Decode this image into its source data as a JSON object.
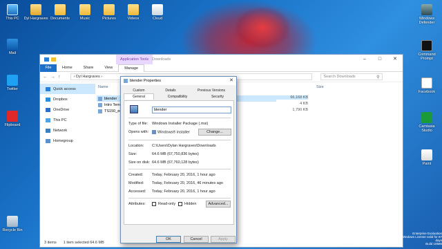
{
  "desktop": {
    "top_icons": [
      {
        "label": "This PC",
        "icon": "computer-icon"
      },
      {
        "label": "Dyl Hargraves",
        "icon": "user-folder-icon"
      },
      {
        "label": "Documents",
        "icon": "folder-icon"
      },
      {
        "label": "Music",
        "icon": "folder-icon"
      },
      {
        "label": "Pictures",
        "icon": "folder-icon"
      },
      {
        "label": "Videos",
        "icon": "folder-icon"
      },
      {
        "label": "Cloud",
        "icon": "cloud-icon"
      }
    ],
    "left_icons": [
      {
        "label": "Mail",
        "icon": "mail-icon"
      },
      {
        "label": "Twitter",
        "icon": "twitter-icon"
      },
      {
        "label": "Flipboard",
        "icon": "flipboard-icon"
      },
      {
        "label": "Recycle Bin",
        "icon": "recycle-bin-icon"
      }
    ],
    "right_icons": [
      {
        "label": "Windows Defender",
        "icon": "defender-icon"
      },
      {
        "label": "Command Prompt",
        "icon": "cmd-icon"
      },
      {
        "label": "Facebook",
        "icon": "facebook-icon"
      },
      {
        "label": "Camtasia Studio",
        "icon": "camtasia-icon"
      },
      {
        "label": "Paint",
        "icon": "paint-icon"
      }
    ],
    "eval_text": "Enterprise Evaluation\nWindows License valid for 87 days\nBuild 10586"
  },
  "explorer": {
    "app_tools": "Application Tools",
    "title": "Downloads",
    "ribbon_tabs": {
      "file": "File",
      "home": "Home",
      "share": "Share",
      "view": "View",
      "manage": "Manage"
    },
    "address": "› Dyl Hargraves ›",
    "search_placeholder": "Search Downloads",
    "nav": [
      {
        "label": "Quick access",
        "icon": "star-icon"
      },
      {
        "label": "Dropbox",
        "icon": "dropbox-icon"
      },
      {
        "label": "OneDrive",
        "icon": "onedrive-icon"
      },
      {
        "label": "This PC",
        "icon": "computer-icon"
      },
      {
        "label": "Network",
        "icon": "network-icon"
      },
      {
        "label": "Homegroup",
        "icon": "homegroup-icon"
      }
    ],
    "columns": {
      "name": "Name",
      "size": "Size"
    },
    "files": [
      {
        "name": "blender",
        "size": "66,168 KB"
      },
      {
        "name": "Intro Tem",
        "size": "4 KB"
      },
      {
        "name": "TS150_en",
        "size": "1,790 KB"
      }
    ],
    "status": {
      "items": "3 items",
      "selected": "1 item selected  64.6 MB"
    }
  },
  "dialog": {
    "title": "blender Properties",
    "tabs": {
      "custom": "Custom",
      "details": "Details",
      "previous": "Previous Versions",
      "general": "General",
      "compat": "Compatibility",
      "security": "Security"
    },
    "filename": "blender",
    "type_label": "Type of file:",
    "type_value": "Windows Installer Package (.msi)",
    "opens_label": "Opens with:",
    "opens_value": "Windows® installer",
    "change_btn": "Change...",
    "location_label": "Location:",
    "location_value": "C:\\Users\\Dylan Hargraves\\Downloads",
    "size_label": "Size:",
    "size_value": "64.6 MB (67,750,836 bytes)",
    "size_disk_label": "Size on disk:",
    "size_disk_value": "64.6 MB (67,760,128 bytes)",
    "created_label": "Created:",
    "created_value": "Today, February 20, 2016, 1 hour ago",
    "modified_label": "Modified:",
    "modified_value": "Today, February 20, 2016, 46 minutes ago",
    "accessed_label": "Accessed:",
    "accessed_value": "Today, February 20, 2016, 1 hour ago",
    "attributes_label": "Attributes:",
    "readonly_label": "Read-only",
    "hidden_label": "Hidden",
    "advanced_btn": "Advanced...",
    "ok_btn": "OK",
    "cancel_btn": "Cancel",
    "apply_btn": "Apply"
  }
}
